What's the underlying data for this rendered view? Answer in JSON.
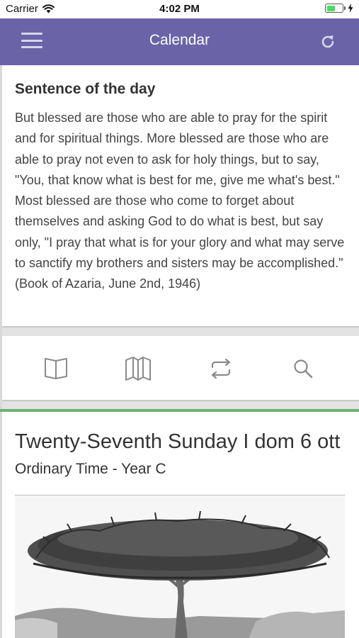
{
  "status_bar": {
    "carrier": "Carrier",
    "time": "4:02 PM",
    "battery_level": 0.55
  },
  "nav": {
    "title": "Calendar",
    "menu_icon": "hamburger-menu-icon",
    "refresh_icon": "refresh-icon"
  },
  "sentence": {
    "title": "Sentence of the day",
    "text": "But blessed are those who are able to pray for the spirit and for spiritual things. More blessed are those who are able to pray not even to ask for holy things, but to say, \"You, that know what is best for me, give me what's best.\" Most blessed are those who come to forget about themselves and asking God to do what is best, but say only, \"I pray that what is for your glory and what may serve to sanctify my brothers and sisters may be accomplished.\" (Book of Azaria, June 2nd, 1946)"
  },
  "toolbar": {
    "icons": [
      "open-book-icon",
      "map-icon",
      "repeat-icon",
      "search-icon"
    ]
  },
  "day": {
    "title": "Twenty-Seventh Sunday I dom 6 ott",
    "subtitle": "Ordinary Time - Year C"
  },
  "colors": {
    "nav_background": "#6a63a8",
    "accent_line": "#6eb26e",
    "icon_gray": "#8a8a8a",
    "battery": "#4cd964"
  }
}
